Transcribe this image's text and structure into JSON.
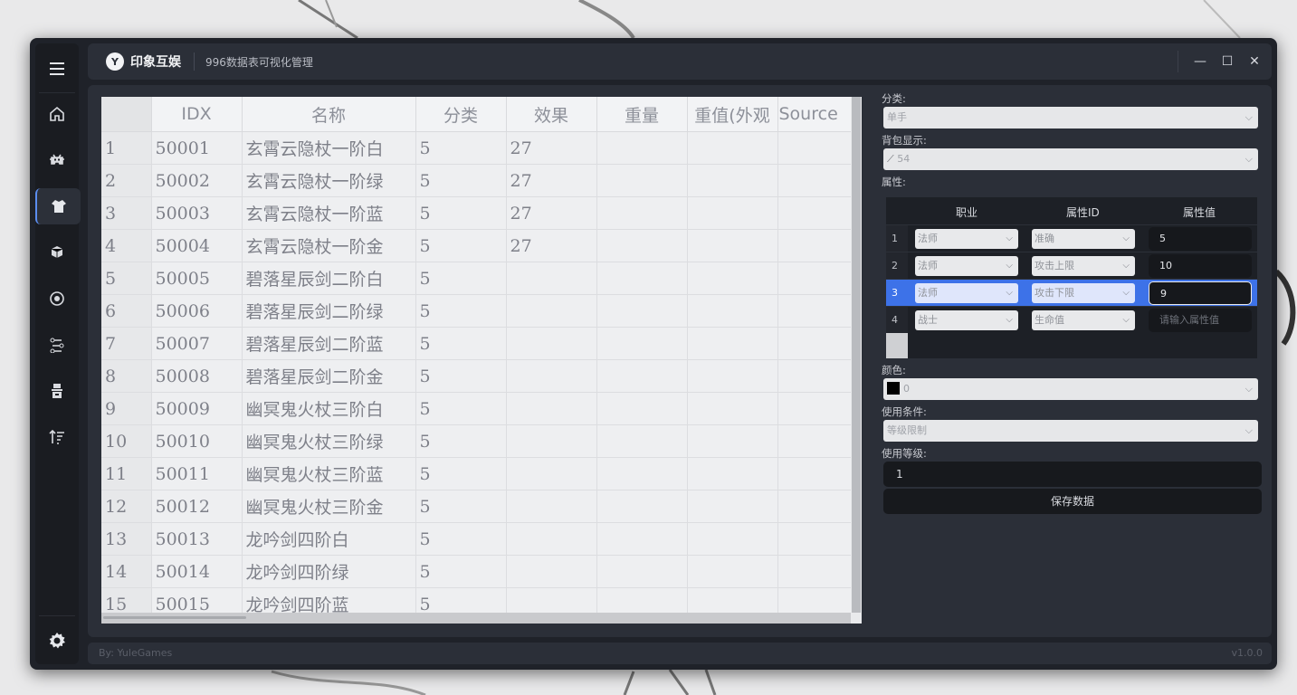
{
  "app": {
    "brand": "印象互娱",
    "brand_mark": "Y",
    "title": "996数据表可视化管理",
    "controls": {
      "minimize": "—",
      "maximize": "☐",
      "close": "✕"
    }
  },
  "sidebar": {
    "items": [
      {
        "name": "menu",
        "icon": "hamburger-icon"
      },
      {
        "name": "home",
        "icon": "home-icon"
      },
      {
        "name": "monster",
        "icon": "monster-icon"
      },
      {
        "name": "item",
        "icon": "armor-icon",
        "active": true
      },
      {
        "name": "cube",
        "icon": "cube-icon"
      },
      {
        "name": "skill",
        "icon": "gear-circle-icon"
      },
      {
        "name": "route",
        "icon": "route-icon"
      },
      {
        "name": "npc",
        "icon": "npc-icon"
      },
      {
        "name": "sort",
        "icon": "sort-icon"
      },
      {
        "name": "settings",
        "icon": "settings-icon"
      }
    ]
  },
  "table": {
    "columns": [
      "IDX",
      "名称",
      "分类",
      "效果",
      "重量",
      "重值(外观",
      "Source"
    ],
    "rows": [
      {
        "n": "1",
        "idx": "50001",
        "name": "玄霄云隐杖一阶白",
        "cat": "5",
        "eff": "27"
      },
      {
        "n": "2",
        "idx": "50002",
        "name": "玄霄云隐杖一阶绿",
        "cat": "5",
        "eff": "27"
      },
      {
        "n": "3",
        "idx": "50003",
        "name": "玄霄云隐杖一阶蓝",
        "cat": "5",
        "eff": "27"
      },
      {
        "n": "4",
        "idx": "50004",
        "name": "玄霄云隐杖一阶金",
        "cat": "5",
        "eff": "27"
      },
      {
        "n": "5",
        "idx": "50005",
        "name": "碧落星辰剑二阶白",
        "cat": "5",
        "eff": ""
      },
      {
        "n": "6",
        "idx": "50006",
        "name": "碧落星辰剑二阶绿",
        "cat": "5",
        "eff": ""
      },
      {
        "n": "7",
        "idx": "50007",
        "name": "碧落星辰剑二阶蓝",
        "cat": "5",
        "eff": ""
      },
      {
        "n": "8",
        "idx": "50008",
        "name": "碧落星辰剑二阶金",
        "cat": "5",
        "eff": ""
      },
      {
        "n": "9",
        "idx": "50009",
        "name": "幽冥鬼火杖三阶白",
        "cat": "5",
        "eff": ""
      },
      {
        "n": "10",
        "idx": "50010",
        "name": "幽冥鬼火杖三阶绿",
        "cat": "5",
        "eff": ""
      },
      {
        "n": "11",
        "idx": "50011",
        "name": "幽冥鬼火杖三阶蓝",
        "cat": "5",
        "eff": ""
      },
      {
        "n": "12",
        "idx": "50012",
        "name": "幽冥鬼火杖三阶金",
        "cat": "5",
        "eff": ""
      },
      {
        "n": "13",
        "idx": "50013",
        "name": "龙吟剑四阶白",
        "cat": "5",
        "eff": ""
      },
      {
        "n": "14",
        "idx": "50014",
        "name": "龙吟剑四阶绿",
        "cat": "5",
        "eff": ""
      },
      {
        "n": "15",
        "idx": "50015",
        "name": "龙吟剑四阶蓝",
        "cat": "5",
        "eff": ""
      }
    ]
  },
  "form": {
    "category_label": "分类:",
    "category_value": "单手",
    "bag_label": "背包显示:",
    "bag_value": "54",
    "attr_label": "属性:",
    "attr_headers": {
      "job": "职业",
      "attr_id": "属性ID",
      "attr_val": "属性值"
    },
    "attrs": [
      {
        "n": "1",
        "job": "法师",
        "attr": "准确",
        "val": "5",
        "placeholder": false
      },
      {
        "n": "2",
        "job": "法师",
        "attr": "攻击上限",
        "val": "10",
        "placeholder": false
      },
      {
        "n": "3",
        "job": "法师",
        "attr": "攻击下限",
        "val": "9",
        "placeholder": false,
        "selected": true
      },
      {
        "n": "4",
        "job": "战士",
        "attr": "生命值",
        "val": "请输入属性值",
        "placeholder": true
      }
    ],
    "color_label": "颜色:",
    "color_value": "0",
    "condition_label": "使用条件:",
    "condition_value": "等级限制",
    "level_label": "使用等级:",
    "level_value": "1",
    "save_label": "保存数据"
  },
  "status": {
    "author": "By: YuleGames",
    "version": "v1.0.0"
  },
  "colors": {
    "accent": "#3d72e8",
    "window": "#1f2229",
    "panel": "#2b2f38"
  }
}
